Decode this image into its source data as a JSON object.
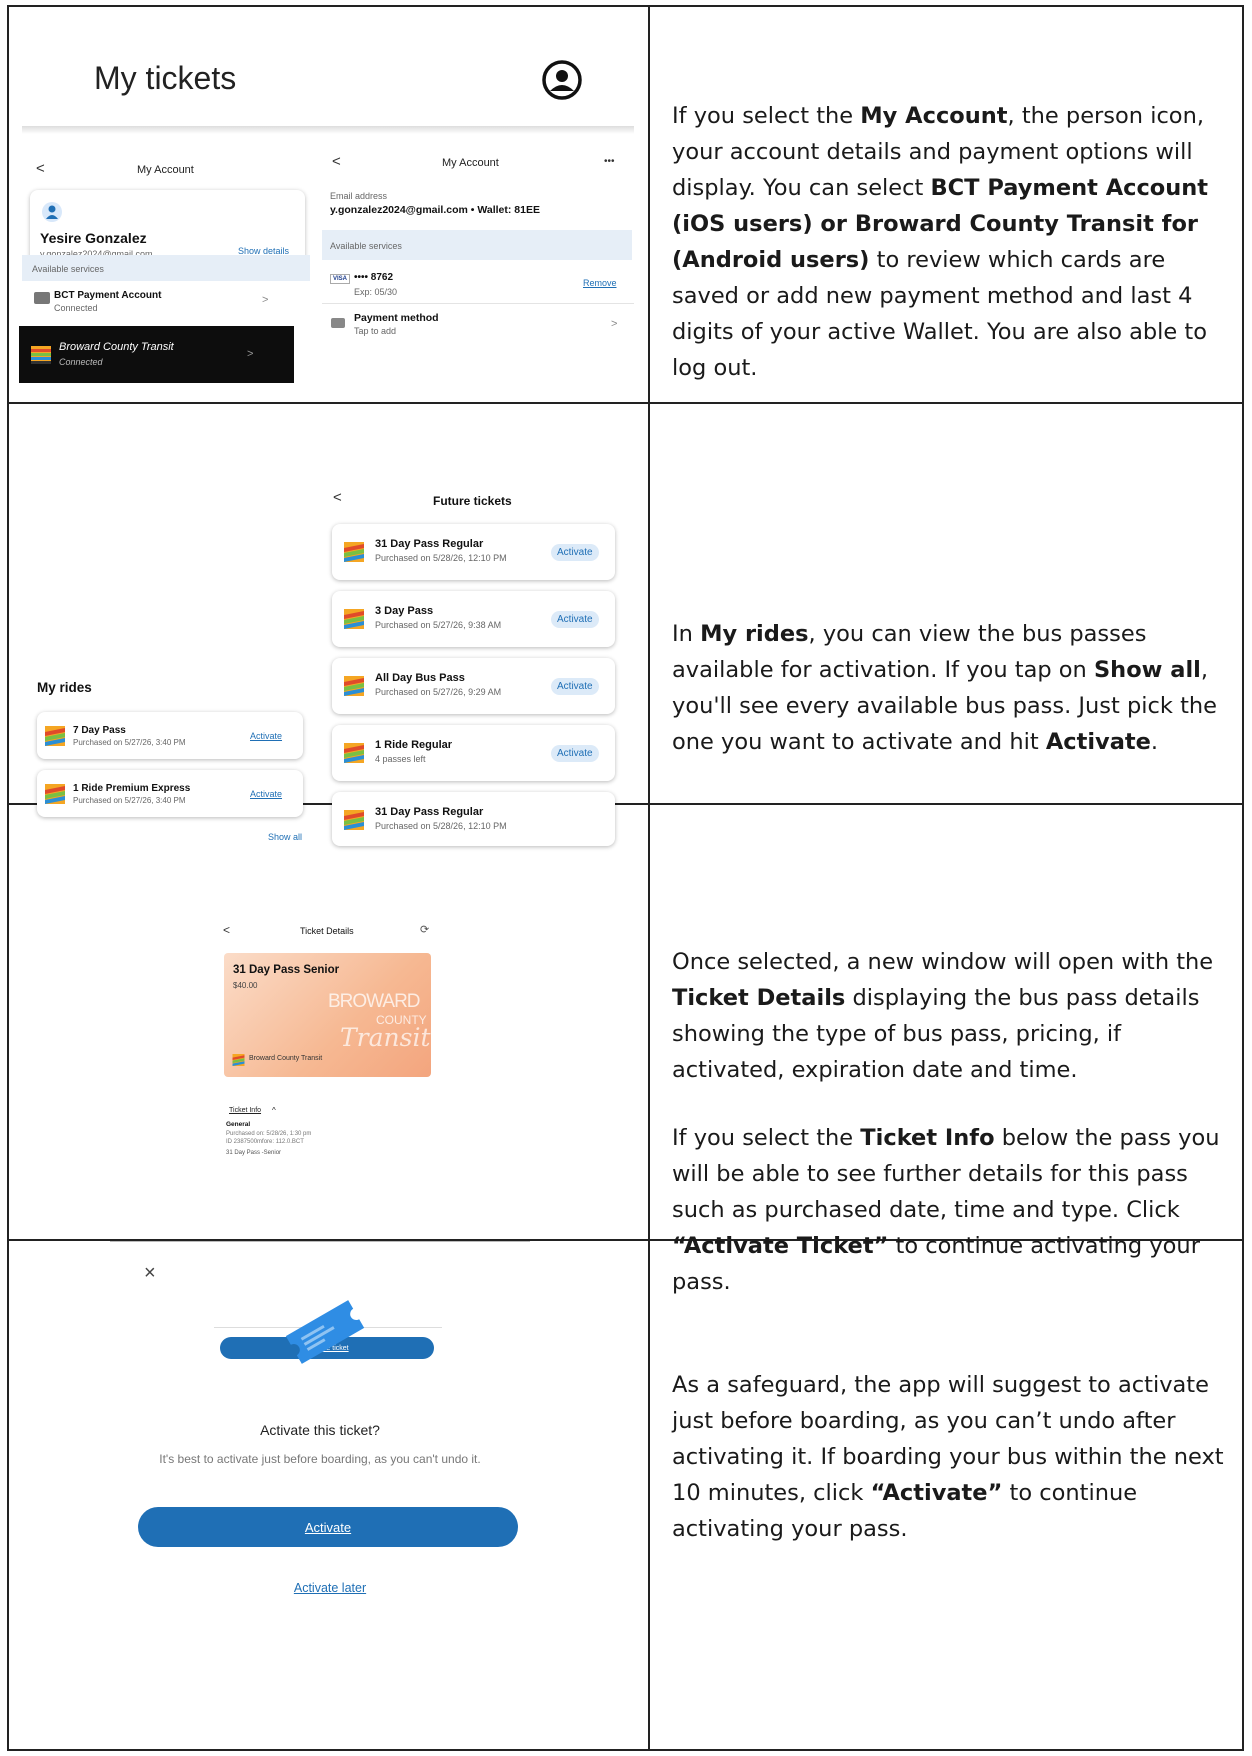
{
  "row1": {
    "heading": "My tickets",
    "left_panel": {
      "back": "<",
      "title": "My Account",
      "name": "Yesire Gonzalez",
      "email": "y.gonzalez2024@gmail.com",
      "show_details": "Show details",
      "services_label": "Available services",
      "service1_title": "BCT Payment Account",
      "service1_sub": "Connected",
      "service2_title": "Broward County Transit",
      "service2_sub": "Connected",
      "chevron": ">"
    },
    "right_panel": {
      "back": "<",
      "title": "My Account",
      "more": "•••",
      "email_label": "Email address",
      "email_value": "y.gonzalez2024@gmail.com • Wallet: 81EE",
      "services_label": "Available services",
      "card_brand": "VISA",
      "card_number": "•••• 8762",
      "card_exp": "Exp: 05/30",
      "remove": "Remove",
      "pm_title": "Payment method",
      "pm_sub": "Tap to add",
      "chevron": ">"
    },
    "text_parts": [
      [
        "If you select the ",
        false
      ],
      [
        "My Account",
        true
      ],
      [
        ", the person icon, your account details and payment options will display. You can select ",
        false
      ],
      [
        "BCT Payment Account (iOS users) or Broward County Transit for (Android users)",
        true
      ],
      [
        " to review which cards are saved or add new payment method and last 4 digits of your active Wallet. You are also able to log out.",
        false
      ]
    ]
  },
  "row2": {
    "my_rides": {
      "title": "My rides",
      "items": [
        {
          "title": "7 Day Pass",
          "sub": "Purchased on 5/27/26, 3:40 PM",
          "action": "Activate"
        },
        {
          "title": "1 Ride Premium Express",
          "sub": "Purchased on 5/27/26, 3:40 PM",
          "action": "Activate"
        }
      ],
      "show_all": "Show all"
    },
    "future": {
      "back": "<",
      "title": "Future tickets",
      "items": [
        {
          "title": "31 Day Pass Regular",
          "sub": "Purchased on 5/28/26, 12:10 PM",
          "action": "Activate"
        },
        {
          "title": "3 Day Pass",
          "sub": "Purchased on 5/27/26, 9:38 AM",
          "action": "Activate"
        },
        {
          "title": "All Day Bus Pass",
          "sub": "Purchased on 5/27/26, 9:29 AM",
          "action": "Activate"
        },
        {
          "title": "1 Ride Regular",
          "sub": "4 passes left",
          "action": "Activate"
        },
        {
          "title": "31 Day Pass Regular",
          "sub": "Purchased on 5/28/26, 12:10 PM",
          "action": ""
        }
      ]
    },
    "text_parts": [
      [
        "In ",
        false
      ],
      [
        "My rides",
        true
      ],
      [
        ", you can view the bus passes available for activation. If you tap on ",
        false
      ],
      [
        "Show all",
        true
      ],
      [
        ", you'll see every available bus pass. Just pick the one you want to activate and hit ",
        false
      ],
      [
        "Activate",
        true
      ],
      [
        ".",
        false
      ]
    ]
  },
  "row3": {
    "back": "<",
    "title": "Ticket Details",
    "refresh": "⟳",
    "pass_name": "31 Day Pass Senior",
    "pass_price": "$40.00",
    "logo_word1": "BROWARD",
    "logo_word2": "COUNTY",
    "logo_word3": "Transit",
    "agency": "Broward County Transit",
    "ticket_info": "Ticket Info",
    "ticket_info_caret": "^",
    "general": "General",
    "info_line1": "Purchased on: 5/28/26, 1:30 pm",
    "info_line2": "ID 2387500mfore: 112.0.BCT",
    "info_line3": "31 Day Pass -Senior",
    "activate_button": "Activate ticket",
    "text_a_parts": [
      [
        "Once selected, a new window will open with the ",
        false
      ],
      [
        "Ticket Details",
        true
      ],
      [
        " displaying the bus pass details showing the type of bus pass, pricing, if activated, expiration date and time.",
        false
      ]
    ],
    "text_b_parts": [
      [
        "If you select the ",
        false
      ],
      [
        "Ticket Info",
        true
      ],
      [
        " below the pass you will be able to see further details for this pass such as purchased date, time and type. Click ",
        false
      ],
      [
        "“Activate Ticket”",
        true
      ],
      [
        " to continue activating your pass.",
        false
      ]
    ]
  },
  "row4": {
    "close": "×",
    "title": "Activate this ticket?",
    "message": "It's best to activate just before boarding, as you can't undo it.",
    "activate": "Activate",
    "activate_later": "Activate later",
    "text_parts": [
      [
        "As a safeguard, the app will suggest to activate just before boarding, as you can’t undo after activating it. If boarding your bus within the next 10 minutes, click ",
        false
      ],
      [
        "“Activate”",
        true
      ],
      [
        " to continue activating your pass.",
        false
      ]
    ]
  }
}
